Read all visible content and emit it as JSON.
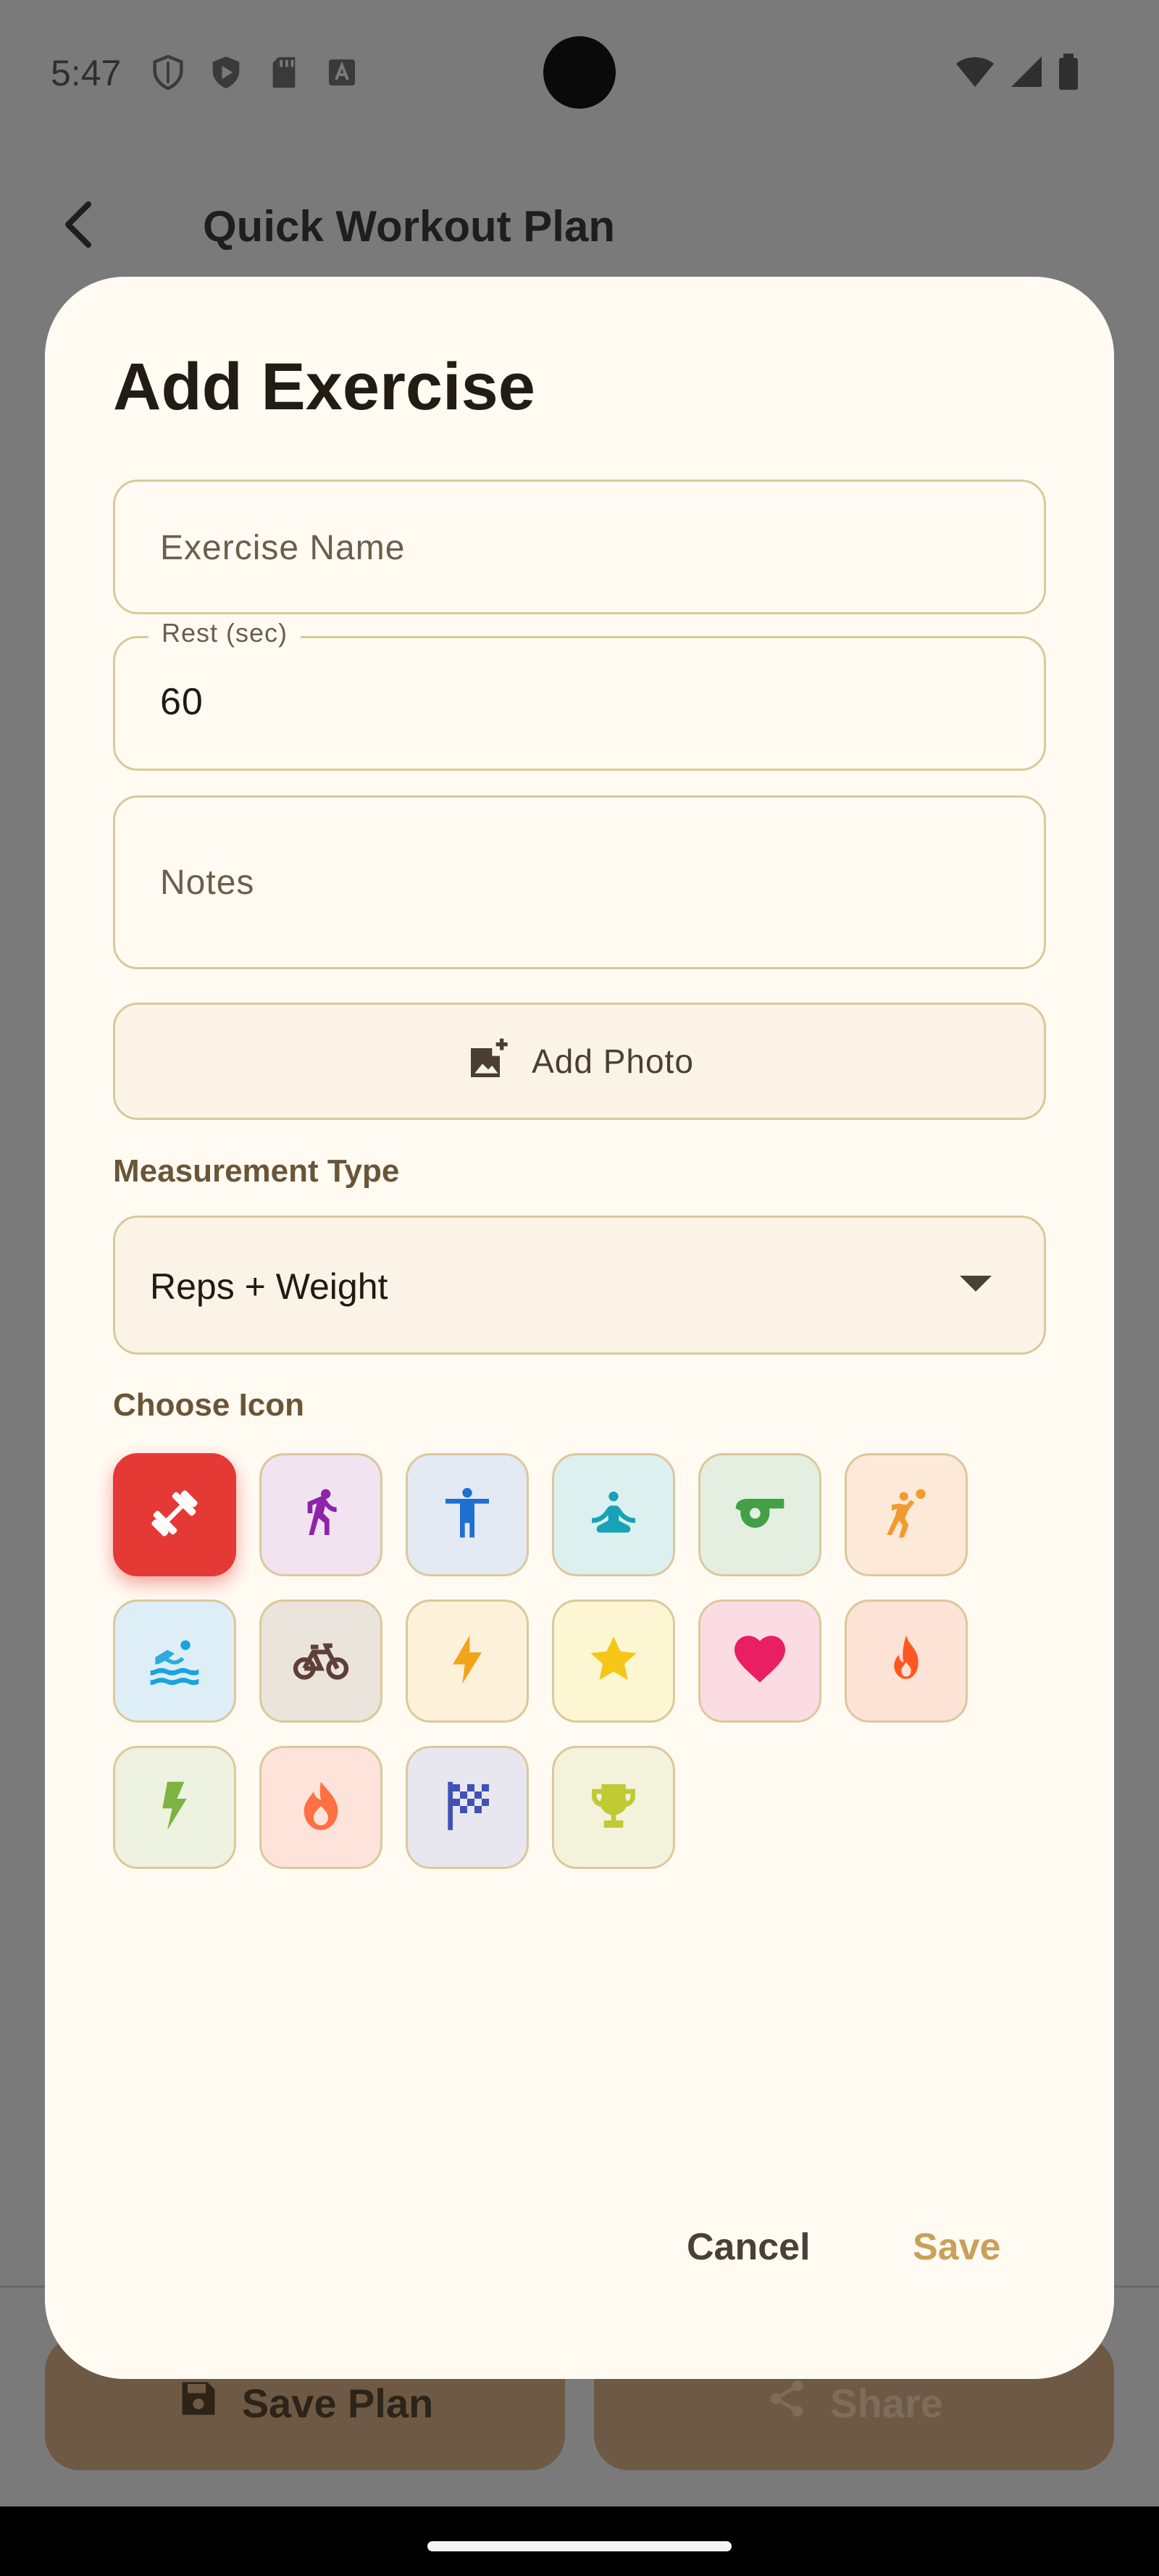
{
  "status_bar": {
    "time": "5:47",
    "left_icons": [
      "shield-outline-icon",
      "play-shield-icon",
      "sd-card-icon",
      "text-a-icon"
    ],
    "right_icons": [
      "wifi-icon",
      "signal-icon",
      "battery-icon"
    ]
  },
  "background": {
    "title": "Quick Workout Plan",
    "save_plan_label": "Save Plan",
    "share_label": "Share"
  },
  "dialog": {
    "title": "Add Exercise",
    "exercise_name": {
      "placeholder": "Exercise Name",
      "value": ""
    },
    "rest": {
      "label": "Rest (sec)",
      "value": "60"
    },
    "notes": {
      "placeholder": "Notes",
      "value": ""
    },
    "add_photo_label": "Add Photo",
    "measurement_type_label": "Measurement Type",
    "measurement_type_value": "Reps + Weight",
    "choose_icon_label": "Choose Icon",
    "icons": [
      {
        "name": "dumbbell-icon",
        "color": "#ffffff",
        "bg": "#e53935",
        "selected": true
      },
      {
        "name": "runner-icon",
        "color": "#8e24aa",
        "bg": "#f1e3ef",
        "selected": false
      },
      {
        "name": "accessibility-icon",
        "color": "#1e6fd0",
        "bg": "#e3eaf3",
        "selected": false
      },
      {
        "name": "meditation-icon",
        "color": "#17a2b8",
        "bg": "#ddf0f0",
        "selected": false
      },
      {
        "name": "whistle-icon",
        "color": "#43a047",
        "bg": "#e5efe1",
        "selected": false
      },
      {
        "name": "handball-icon",
        "color": "#f29a2e",
        "bg": "#fde9d7",
        "selected": false
      },
      {
        "name": "swimming-icon",
        "color": "#1aa3dc",
        "bg": "#ddeef6",
        "selected": false
      },
      {
        "name": "bicycle-icon",
        "color": "#5d4037",
        "bg": "#ebe4dc",
        "selected": false
      },
      {
        "name": "bolt-outline-icon",
        "color": "#f2a51a",
        "bg": "#fdf1d9",
        "selected": false
      },
      {
        "name": "star-icon",
        "color": "#f5c518",
        "bg": "#fdf6d3",
        "selected": false
      },
      {
        "name": "heart-icon",
        "color": "#e91e63",
        "bg": "#fbdce3",
        "selected": false
      },
      {
        "name": "fire-icon",
        "color": "#ff5722",
        "bg": "#fde2d6",
        "selected": false
      },
      {
        "name": "bolt-icon",
        "color": "#7cb342",
        "bg": "#eef2e0",
        "selected": false
      },
      {
        "name": "flame-icon",
        "color": "#ff7043",
        "bg": "#fde3d9",
        "selected": false
      },
      {
        "name": "checkered-flag-icon",
        "color": "#3f51b5",
        "bg": "#e8e7f0",
        "selected": false
      },
      {
        "name": "trophy-icon",
        "color": "#c0ca33",
        "bg": "#f3f3dc",
        "selected": false
      }
    ],
    "cancel_label": "Cancel",
    "save_label": "Save"
  }
}
